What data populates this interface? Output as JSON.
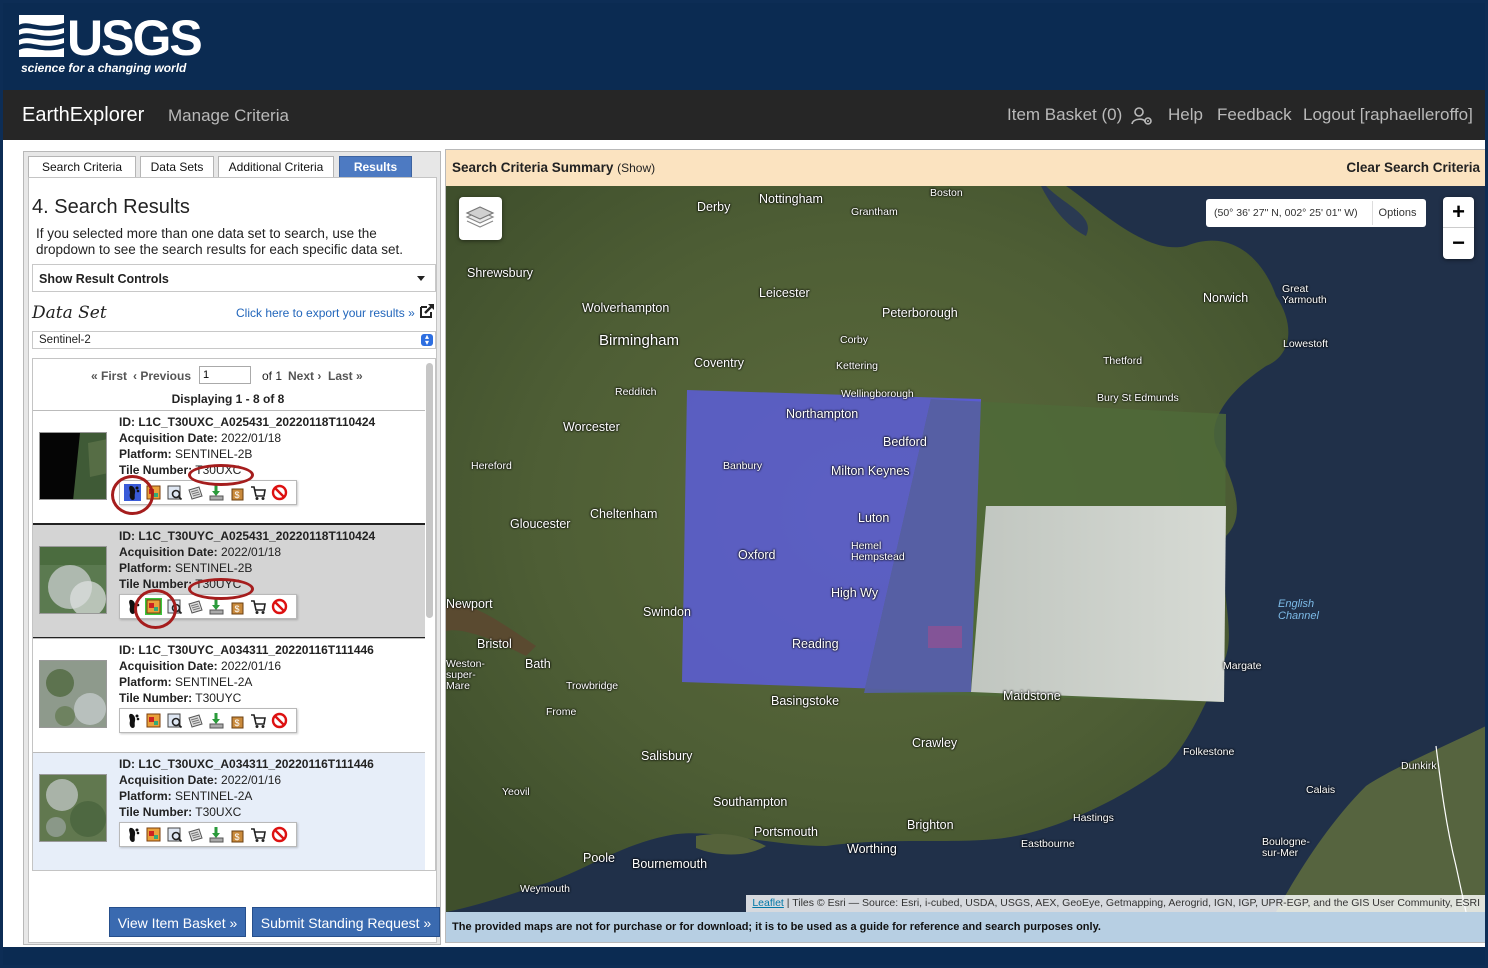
{
  "header": {
    "logo_text": "USGS",
    "logo_tagline": "science for a changing world",
    "app_name": "EarthExplorer",
    "manage_criteria": "Manage Criteria",
    "item_basket": "Item Basket (0)",
    "help": "Help",
    "feedback": "Feedback",
    "logout": "Logout [raphaelleroffo]"
  },
  "tabs": [
    "Search Criteria",
    "Data Sets",
    "Additional Criteria",
    "Results"
  ],
  "active_tab": "Results",
  "results_panel": {
    "title": "4. Search Results",
    "description": "If you selected more than one data set to search, use the dropdown to see the search results for each specific data set.",
    "show_result_controls": "Show Result Controls",
    "data_set_label": "Data Set",
    "export_link": "Click here to export your results »",
    "data_set_selected": "Sentinel-2",
    "pager": {
      "first": "« First",
      "previous": "‹ Previous",
      "page_value": "1",
      "of_label": "of 1",
      "next": "Next ›",
      "last": "Last »"
    },
    "displaying": "Displaying 1 - 8 of 8",
    "labels": {
      "acquisition": "Acquisition Date:",
      "platform": "Platform:",
      "tile": "Tile Number:"
    },
    "items": [
      {
        "id": "ID: L1C_T30UXC_A025431_20220118T110424",
        "date": "2022/01/18",
        "platform": "SENTINEL-2B",
        "tile": "T30UXC"
      },
      {
        "id": "ID: L1C_T30UYC_A025431_20220118T110424",
        "date": "2022/01/18",
        "platform": "SENTINEL-2B",
        "tile": "T30UYC"
      },
      {
        "id": "ID: L1C_T30UYC_A034311_20220116T111446",
        "date": "2022/01/16",
        "platform": "SENTINEL-2A",
        "tile": "T30UYC"
      },
      {
        "id": "ID: L1C_T30UXC_A034311_20220116T111446",
        "date": "2022/01/16",
        "platform": "SENTINEL-2A",
        "tile": "T30UXC"
      }
    ],
    "row_icons": [
      "footprint-icon",
      "browse-overlay-icon",
      "metadata-icon",
      "compare-icon",
      "download-icon",
      "order-icon",
      "cart-icon",
      "exclude-icon"
    ],
    "view_basket_button": "View Item Basket »",
    "standing_request_button": "Submit Standing Request »"
  },
  "map_panel": {
    "summary_label": "Search Criteria Summary",
    "summary_toggle": "(Show)",
    "clear_criteria": "Clear Search Criteria",
    "coordinates": "(50° 36' 27\" N, 002° 25' 01\" W)",
    "options": "Options",
    "zoom_in": "+",
    "zoom_out": "−",
    "attribution_link": "Leaflet",
    "attribution_text": " | Tiles © Esri — Source: Esri, i-cubed, USDA, USGS, AEX, GeoEye, Getmapping, Aerogrid, IGN, IGP, UPR-EGP, and the GIS User Community, ESRI",
    "disclaimer": "The provided maps are not for purchase or for download; it is to be used as a guide for reference and search purposes only.",
    "places": [
      "Derby",
      "Nottingham",
      "Grantham",
      "Boston",
      "Shrewsbury",
      "Leicester",
      "Norwich",
      "Great Yarmouth",
      "Wolverhampton",
      "Peterborough",
      "Birmingham",
      "Corby",
      "Lowestoft",
      "Coventry",
      "Kettering",
      "Thetford",
      "Redditch",
      "Wellingborough",
      "Bury St Edmunds",
      "Worcester",
      "Northampton",
      "Bedford",
      "Hereford",
      "Banbury",
      "Milton Keynes",
      "Cheltenham",
      "Gloucester",
      "Luton",
      "Oxford",
      "Hemel Hempstead",
      "High Wy",
      "Newport",
      "Swindon",
      "English Channel",
      "Bristol",
      "Reading",
      "Bath",
      "Weston-super-Mare",
      "Margate",
      "Trowbridge",
      "Basingstoke",
      "Maidstone",
      "Frome",
      "Crawley",
      "Salisbury",
      "Folkestone",
      "Dunkirk",
      "Yeovil",
      "Calais",
      "Southampton",
      "Hastings",
      "Portsmouth",
      "Brighton",
      "Eastbourne",
      "Boulogne-sur-Mer",
      "Worthing",
      "Poole",
      "Bournemouth",
      "Weymouth"
    ]
  },
  "colors": {
    "usgs_navy": "#0b2b52",
    "nav_dark": "#262626",
    "tab_active": "#4d7ac2",
    "button_blue": "#3a6ab0",
    "footprint_blue": "#5a5adc",
    "summary_bg": "#fbe3c0",
    "disclaimer_bg": "#b7cfe3",
    "highlight_circle": "#a51d1d"
  }
}
